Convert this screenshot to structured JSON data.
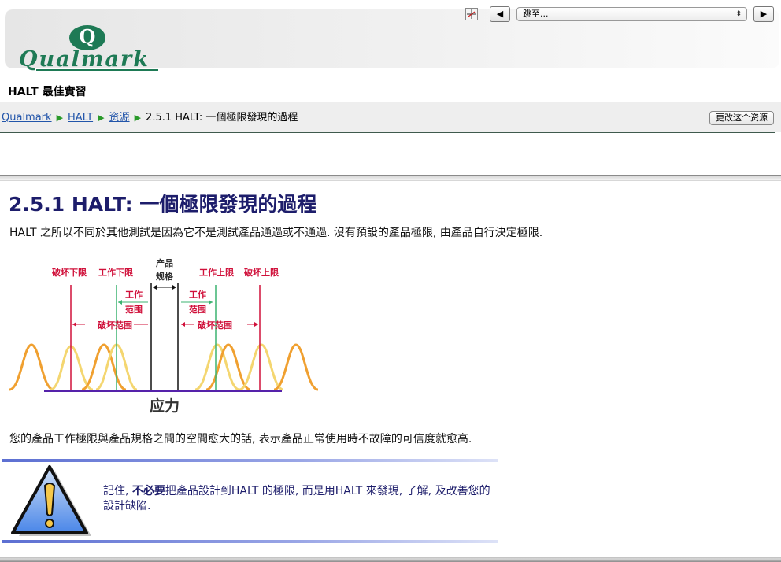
{
  "header": {
    "logo_letter": "Q",
    "logo_text": "Qualmark",
    "brand_color": "#1e7a55",
    "jump_placeholder": "跳至...",
    "prev_symbol": "◀",
    "next_symbol": "▶"
  },
  "course_title": "HALT 最佳實習",
  "breadcrumb": {
    "items": [
      "Qualmark",
      "HALT",
      "资源"
    ],
    "current": "2.5.1 HALT: 一個極限發現的過程"
  },
  "update_button": "更改这个资源",
  "page": {
    "heading": "2.5.1 HALT: 一個極限發現的過程",
    "intro": "HALT 之所以不同於其他測試是因為它不是測試產品通過或不通過. 沒有預設的產品極限, 由產品自行決定極限.",
    "conclusion": "您的產品工作極限與產品規格之間的空間愈大的話, 表示產品正常使用時不故障的可信度就愈高."
  },
  "diagram": {
    "destruct_lower": "破坏下限",
    "operate_lower": "工作下限",
    "spec_line1": "产品",
    "spec_line2": "规格",
    "operate_upper": "工作上限",
    "destruct_upper": "破坏上限",
    "operate_range_line1": "工作",
    "operate_range_line2": "范围",
    "destruct_range": "破坏范围",
    "axis_label": "应力",
    "colors": {
      "label_red": "#d0103a",
      "green": "#3cb371",
      "orange": "#f0a030",
      "yellow": "#f4d670",
      "axis_blue": "#5522aa"
    }
  },
  "note": {
    "prefix": "記住, ",
    "bold": "不必要",
    "rest": "把產品設計到HALT 的極限, 而是用HALT 來發現, 了解, 及改善您的設計缺陷."
  }
}
